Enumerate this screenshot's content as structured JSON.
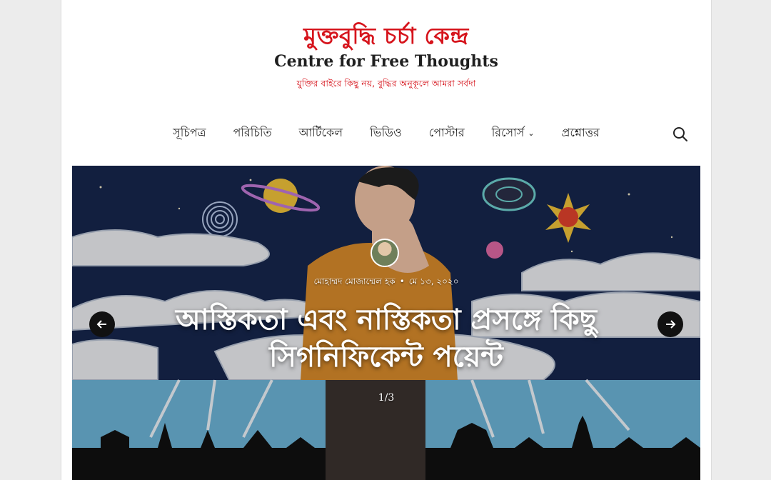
{
  "site": {
    "logo_bn": "মুক্তবুদ্ধি চর্চা কেন্দ্র",
    "logo_en": "Centre for Free Thoughts",
    "tagline": "যুক্তির বাইরে কিছু নয়, বুদ্ধির অনুকূলে আমরা সর্বদা"
  },
  "nav": {
    "items": [
      {
        "label": "সূচিপত্র"
      },
      {
        "label": "পরিচিতি"
      },
      {
        "label": "আর্টিকেল"
      },
      {
        "label": "ভিডিও"
      },
      {
        "label": "পোস্টার"
      },
      {
        "label": "রিসোর্স",
        "has_dropdown": true
      },
      {
        "label": "প্রশ্নোত্তর"
      }
    ],
    "search_icon": "search-icon"
  },
  "slider": {
    "author": "মোহাম্মদ মোজাম্মেল হক",
    "date": "মে ১৩, ২০২০",
    "title": "আস্তিকতা এবং নাস্তিকতা প্রসঙ্গে কিছু সিগনিফিকেন্ট পয়েন্ট",
    "counter": "1/3",
    "prev_icon": "arrow-left-icon",
    "next_icon": "arrow-right-icon"
  },
  "colors": {
    "brand_red": "#d6141c",
    "page_bg": "#ececec",
    "arrow_bg": "#111111"
  }
}
